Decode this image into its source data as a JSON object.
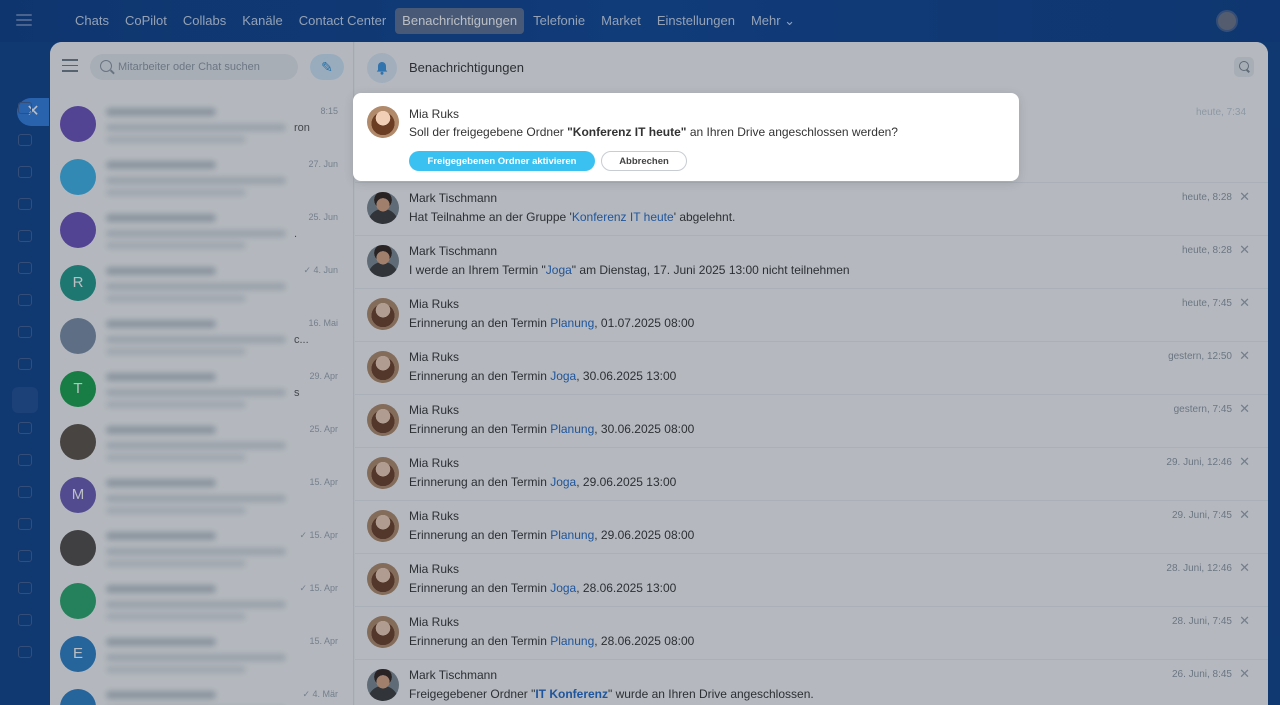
{
  "top_nav": {
    "items": [
      "Chats",
      "CoPilot",
      "Collabs",
      "Kanäle",
      "Contact Center",
      "Benachrichtigungen",
      "Telefonie",
      "Market",
      "Einstellungen",
      "Mehr ⌄"
    ],
    "active_index": 5
  },
  "sidebar": {
    "search_placeholder": "Mitarbeiter oder Chat suchen",
    "chats": [
      {
        "avatar_letter": "",
        "avatar_color": "#6b4fbb",
        "date": "8:15",
        "fragment": "ron"
      },
      {
        "avatar_letter": "",
        "avatar_color": "#3bb4ea",
        "date": "27. Jun",
        "fragment": ""
      },
      {
        "avatar_letter": "",
        "avatar_color": "#6b4fbb",
        "date": "25. Jun",
        "fragment": "."
      },
      {
        "avatar_letter": "R",
        "avatar_color": "#1f9a8a",
        "date": "✓ 4. Jun",
        "fragment": ""
      },
      {
        "avatar_letter": "",
        "avatar_color": "#7a8fa6",
        "date": "16. Mai",
        "fragment": "c..."
      },
      {
        "avatar_letter": "T",
        "avatar_color": "#16a34a",
        "date": "29. Apr",
        "fragment": "s"
      },
      {
        "avatar_letter": "",
        "avatar_color": "#5b5145",
        "date": "25. Apr",
        "fragment": ""
      },
      {
        "avatar_letter": "M",
        "avatar_color": "#6a5bb6",
        "date": "15. Apr",
        "fragment": ""
      },
      {
        "avatar_letter": "",
        "avatar_color": "#4f4a46",
        "date": "✓ 15. Apr",
        "fragment": ""
      },
      {
        "avatar_letter": "",
        "avatar_color": "#28a86a",
        "date": "✓ 15. Apr",
        "fragment": ""
      },
      {
        "avatar_letter": "E",
        "avatar_color": "#2a7fc8",
        "date": "15. Apr",
        "fragment": ""
      },
      {
        "avatar_letter": "",
        "avatar_color": "#2a7fc8",
        "date": "✓ 4. Mär",
        "fragment": ""
      }
    ]
  },
  "content": {
    "title": "Benachrichtigungen"
  },
  "highlight": {
    "name": "Mia Ruks",
    "text_pre": "Soll der freigegebene Ordner ",
    "text_bold": "\"Konferenz IT heute\"",
    "text_post": " an Ihren Drive angeschlossen werden?",
    "time": "heute, 7:34",
    "btn_primary": "Freigegebenen Ordner aktivieren",
    "btn_secondary": "Abbrechen"
  },
  "notifications": [
    {
      "name": "Mark Tischmann",
      "avatar": "mark",
      "pre": "Hat Teilnahme an der Gruppe '",
      "link": "Konferenz IT heute",
      "post": "' abgelehnt.",
      "time": "heute, 8:28",
      "bold": false
    },
    {
      "name": "Mark Tischmann",
      "avatar": "mark",
      "pre": "I werde an Ihrem Termin \"",
      "link": "Joga",
      "post": "\" am Dienstag, 17. Juni 2025 13:00 nicht teilnehmen",
      "time": "heute, 8:28",
      "bold": false
    },
    {
      "name": "Mia Ruks",
      "avatar": "mia",
      "pre": "Erinnerung an den Termin ",
      "link": "Planung",
      "post": ", 01.07.2025 08:00",
      "time": "heute, 7:45",
      "bold": false
    },
    {
      "name": "Mia Ruks",
      "avatar": "mia",
      "pre": "Erinnerung an den Termin ",
      "link": "Joga",
      "post": ", 30.06.2025 13:00",
      "time": "gestern, 12:50",
      "bold": false
    },
    {
      "name": "Mia Ruks",
      "avatar": "mia",
      "pre": "Erinnerung an den Termin ",
      "link": "Planung",
      "post": ", 30.06.2025 08:00",
      "time": "gestern, 7:45",
      "bold": false
    },
    {
      "name": "Mia Ruks",
      "avatar": "mia",
      "pre": "Erinnerung an den Termin ",
      "link": "Joga",
      "post": ", 29.06.2025 13:00",
      "time": "29. Juni, 12:46",
      "bold": false
    },
    {
      "name": "Mia Ruks",
      "avatar": "mia",
      "pre": "Erinnerung an den Termin ",
      "link": "Planung",
      "post": ", 29.06.2025 08:00",
      "time": "29. Juni, 7:45",
      "bold": false
    },
    {
      "name": "Mia Ruks",
      "avatar": "mia",
      "pre": "Erinnerung an den Termin ",
      "link": "Joga",
      "post": ", 28.06.2025 13:00",
      "time": "28. Juni, 12:46",
      "bold": false
    },
    {
      "name": "Mia Ruks",
      "avatar": "mia",
      "pre": "Erinnerung an den Termin ",
      "link": "Planung",
      "post": ", 28.06.2025 08:00",
      "time": "28. Juni, 7:45",
      "bold": false
    },
    {
      "name": "Mark Tischmann",
      "avatar": "mark",
      "pre": "Freigegebener Ordner \"",
      "link": "IT Konferenz",
      "post": "\" wurde an Ihren Drive angeschlossen.",
      "time": "26. Juni, 8:45",
      "bold": true
    }
  ],
  "icons": {
    "close": "close-icon",
    "bell": "bell-icon",
    "search": "search-icon",
    "compose": "compose-icon",
    "filter": "filter-icon"
  }
}
